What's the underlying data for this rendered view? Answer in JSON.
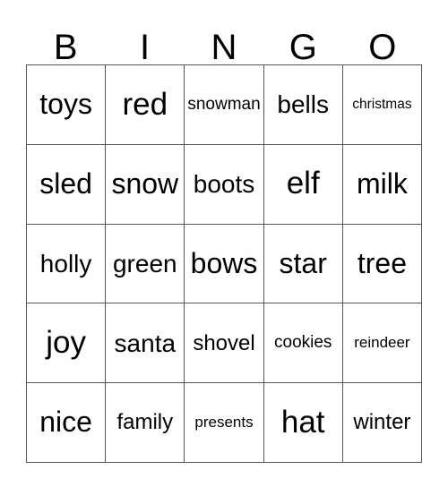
{
  "card": {
    "headers": [
      "B",
      "I",
      "N",
      "G",
      "O"
    ],
    "rows": [
      [
        "toys",
        "red",
        "snowman",
        "bells",
        "christmas"
      ],
      [
        "sled",
        "snow",
        "boots",
        "elf",
        "milk"
      ],
      [
        "holly",
        "green",
        "bows",
        "star",
        "tree"
      ],
      [
        "joy",
        "santa",
        "shovel",
        "cookies",
        "reindeer"
      ],
      [
        "nice",
        "family",
        "presents",
        "hat",
        "winter"
      ]
    ],
    "colors": {
      "text": "#000000",
      "grid_line": "#555555",
      "background": "#ffffff"
    }
  }
}
